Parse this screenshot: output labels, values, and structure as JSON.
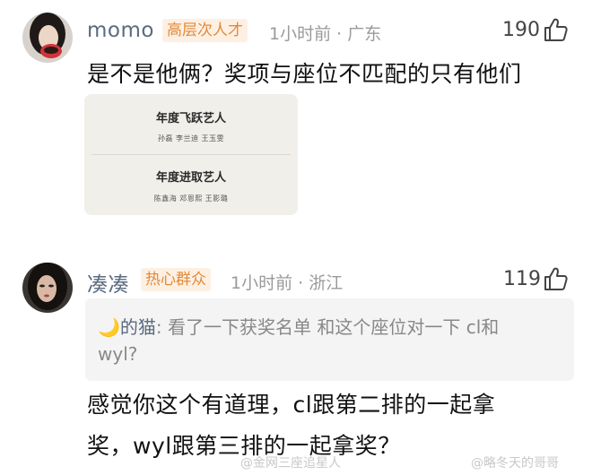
{
  "comments": [
    {
      "username": "momo",
      "badge": "高层次人才",
      "meta": "1小时前 · 广东",
      "likes": "190",
      "text": "是不是他俩？奖项与座位不匹配的只有他们",
      "image": {
        "award1_title": "年度飞跃艺人",
        "award1_names": "孙磊  李兰迪  王玉雯",
        "award2_title": "年度进取艺人",
        "award2_names": "陈鑫海  邓恩熙  王影璐"
      }
    },
    {
      "username": "凑凑",
      "badge": "热心群众",
      "meta": "1小时前 · 浙江",
      "likes": "119",
      "reply": {
        "author": "的猫",
        "line1_rest": ": 看了一下获奖名单 和这个座位对一下 cl和",
        "line2": "wyl?"
      },
      "text_line1": "感觉你这个有道理，cl跟第二排的一起拿",
      "text_line2": "奖，wyl跟第三排的一起拿奖？"
    }
  ],
  "watermarks": [
    "@金网三座追星人",
    "@略冬天的哥哥"
  ]
}
